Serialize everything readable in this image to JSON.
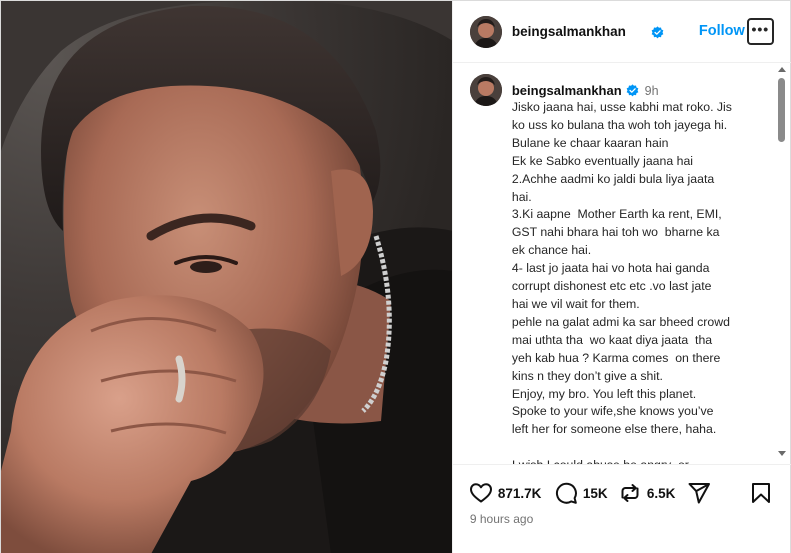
{
  "post": {
    "username": "beingsalmankhan",
    "follow_label": "Follow",
    "more_label": "•••",
    "caption_time": "9h",
    "caption_lines": [
      "Jisko jaana hai, usse kabhi mat roko. Jis",
      "ko uss ko bulana tha woh toh jayega hi.",
      "Bulane ke chaar kaaran hain",
      "Ek ke Sabko eventually jaana hai",
      "2.Achhe aadmi ko jaldi bula liya jaata",
      "hai.",
      "3.Ki aapne  Mother Earth ka rent, EMI,",
      "GST nahi bhara hai toh wo  bharne ka",
      "ek chance hai.",
      "4- last jo jaata hai vo hota hai ganda",
      "corrupt dishonest etc etc .vo last jate",
      "hai we vil wait for them.",
      "pehle na galat admi ka sar bheed crowd",
      "mai uthta tha  wo kaat diya jaata  tha",
      "yeh kab hua ? Karma comes  on there",
      "kins n they don’t give a shit.",
      "Enjoy, my bro. You left this planet.",
      "Spoke to your wife,she knows you’ve",
      "left her for someone else there, haha.",
      "",
      "I wish I could abuse be angry  or"
    ],
    "likes": "871.7K",
    "comments": "15K",
    "reposts": "6.5K",
    "posted_ago": "9 hours ago"
  },
  "colors": {
    "follow": "#0095f6",
    "verified": "#0095f6",
    "muted_text": "#737373"
  },
  "icons": {
    "like": "heart-icon",
    "comment": "comment-icon",
    "repost": "repost-icon",
    "share": "send-icon",
    "save": "bookmark-icon",
    "more": "more-options-icon",
    "verified": "verified-badge-icon"
  }
}
